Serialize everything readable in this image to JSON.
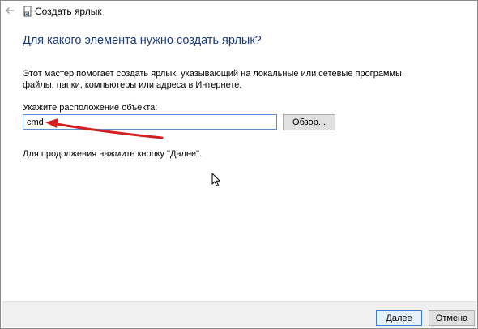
{
  "window": {
    "title": "Создать ярлык",
    "back_icon": "back-arrow-icon",
    "app_icon": "shortcut-icon"
  },
  "main": {
    "heading": "Для какого элемента нужно создать ярлык?",
    "description_lines": [
      "Этот мастер помогает создать ярлык, указывающий на локальные или сетевые программы,",
      "файлы, папки, компьютеры или адреса в Интернете."
    ],
    "location_label": "Укажите расположение объекта:",
    "location_value": "cmd",
    "browse_label": "Обзор...",
    "hint": "Для продолжения нажмите кнопку \"Далее\"."
  },
  "footer": {
    "next_label": "Далее",
    "cancel_label": "Отмена"
  },
  "annotation": {
    "arrow_color": "#d32020"
  },
  "colors": {
    "heading": "#1a3a7a",
    "input_border": "#5a8fd6",
    "footer_bg": "#f0f0f0"
  }
}
